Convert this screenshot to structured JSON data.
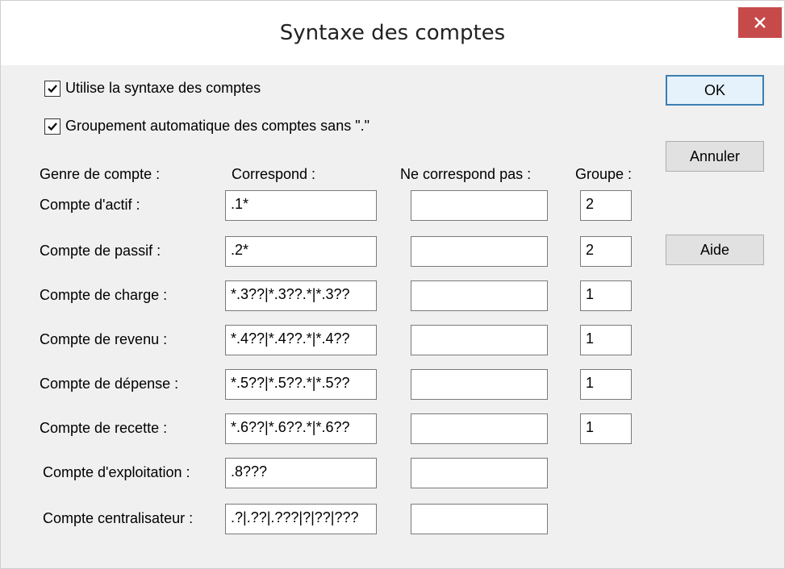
{
  "window": {
    "title": "Syntaxe des comptes"
  },
  "checkboxes": [
    {
      "label": "Utilise la syntaxe des comptes",
      "checked": true
    },
    {
      "label": "Groupement automatique des comptes sans \".\"",
      "checked": true
    }
  ],
  "headers": {
    "genre": "Genre de compte :",
    "correspond": "Correspond :",
    "ne_correspond": "Ne correspond pas :",
    "groupe": "Groupe :"
  },
  "rows": [
    {
      "label": "Compte d'actif :",
      "correspond": ".1*",
      "ne_correspond": "",
      "groupe": "2"
    },
    {
      "label": "Compte de passif :",
      "correspond": ".2*",
      "ne_correspond": "",
      "groupe": "2"
    },
    {
      "label": "Compte de charge :",
      "correspond": "*.3??|*.3??.*|*.3??",
      "ne_correspond": "",
      "groupe": "1"
    },
    {
      "label": "Compte de revenu :",
      "correspond": "*.4??|*.4??.*|*.4??",
      "ne_correspond": "",
      "groupe": "1"
    },
    {
      "label": "Compte de dépense :",
      "correspond": "*.5??|*.5??.*|*.5??",
      "ne_correspond": "",
      "groupe": "1"
    },
    {
      "label": "Compte de recette :",
      "correspond": "*.6??|*.6??.*|*.6??",
      "ne_correspond": "",
      "groupe": "1"
    },
    {
      "label": "Compte d'exploitation :",
      "correspond": ".8???",
      "ne_correspond": ""
    },
    {
      "label": "Compte centralisateur :",
      "correspond": ".?|.??|.???|?|??|???",
      "ne_correspond": ""
    }
  ],
  "buttons": {
    "ok": "OK",
    "cancel": "Annuler",
    "help": "Aide"
  },
  "colors": {
    "close_bg": "#c74a4a",
    "default_border": "#3c7fb1"
  }
}
